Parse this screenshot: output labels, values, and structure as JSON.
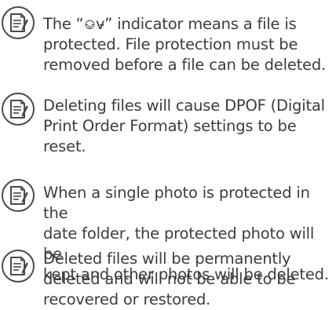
{
  "notes": [
    {
      "icon": "memo-note-icon",
      "text": "The “⎉v̵” indicator means a file is\nprotected. File protection must be\nremoved before a file can be deleted."
    },
    {
      "icon": "memo-note-icon",
      "text": "Deleting files will cause DPOF (Digital\nPrint Order Format) settings to be\nreset."
    },
    {
      "icon": "memo-note-icon",
      "text": "When a single photo is protected in the\ndate folder, the protected photo will be\nkept and other photos will be deleted."
    },
    {
      "icon": "memo-note-icon",
      "text": "Deleted files will be permanently\ndeleted and will not be able to be\nrecovered or restored."
    }
  ],
  "colors": {
    "text": "#3c3c3c",
    "icon_stroke": "#4a4a4a"
  }
}
